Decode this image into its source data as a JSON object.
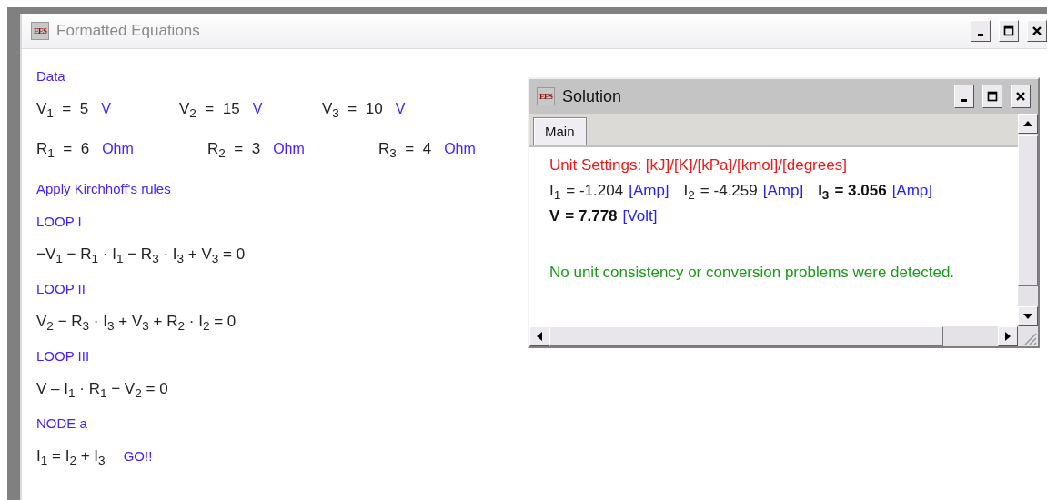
{
  "main_window": {
    "icon_text": "EES",
    "title": "Formatted Equations"
  },
  "lines": [
    {
      "kind": "heading",
      "text": "Data"
    },
    {
      "kind": "assignments",
      "items": [
        {
          "text": "V$_{1}$  =  5",
          "unit": "V"
        },
        {
          "text": "V$_{2}$  =  15",
          "unit": "V"
        },
        {
          "text": "V$_{3}$  =  10",
          "unit": "V"
        }
      ]
    },
    {
      "kind": "assignments",
      "items": [
        {
          "text": "R$_{1}$  =  6",
          "unit": "Ohm"
        },
        {
          "text": "R$_{2}$  =  3",
          "unit": "Ohm"
        },
        {
          "text": "R$_{3}$  =  4",
          "unit": "Ohm"
        }
      ]
    },
    {
      "kind": "heading",
      "text": "Apply Kirchhoff's rules"
    },
    {
      "kind": "heading",
      "text": "LOOP I"
    },
    {
      "kind": "equation",
      "text": "−V$_{1}$ − R$_{1}$ · I$_{1}$ − R$_{3}$ · I$_{3}$ + V$_{3}$ =  0"
    },
    {
      "kind": "heading",
      "text": "LOOP II"
    },
    {
      "kind": "equation",
      "text": "V$_{2}$ − R$_{3}$ · I$_{3}$ + V$_{3}$ + R$_{2}$ · I$_{2}$ =  0"
    },
    {
      "kind": "heading",
      "text": "LOOP III"
    },
    {
      "kind": "equation",
      "text": "V – I$_{1}$ · R$_{1}$ − V$_{2}$ =  0"
    },
    {
      "kind": "heading",
      "text": "NODE a"
    },
    {
      "kind": "equation",
      "text": "I$_{1}$ = I$_{2}$ + I$_{3}$",
      "comment": "GO!!"
    }
  ],
  "solution_window": {
    "icon_text": "EES",
    "title": "Solution",
    "tabs": [
      {
        "label": "Main",
        "selected": true
      }
    ],
    "unit_settings": "Unit Settings: [kJ]/[K]/[kPa]/[kmol]/[degrees]",
    "results": [
      [
        {
          "symbol": "I$_{1}$",
          "value": "= -1.204",
          "unit": "[Amp]",
          "bold": false
        },
        {
          "symbol": "I$_{2}$",
          "value": "= -4.259",
          "unit": "[Amp]",
          "bold": false
        },
        {
          "symbol": "I$_{3}$",
          "value": "= 3.056",
          "unit": "[Amp]",
          "bold": true
        }
      ],
      [
        {
          "symbol": "V",
          "value": "= 7.778",
          "unit": "[Volt]",
          "bold": true
        }
      ]
    ],
    "message": "No unit consistency or conversion problems were detected."
  }
}
